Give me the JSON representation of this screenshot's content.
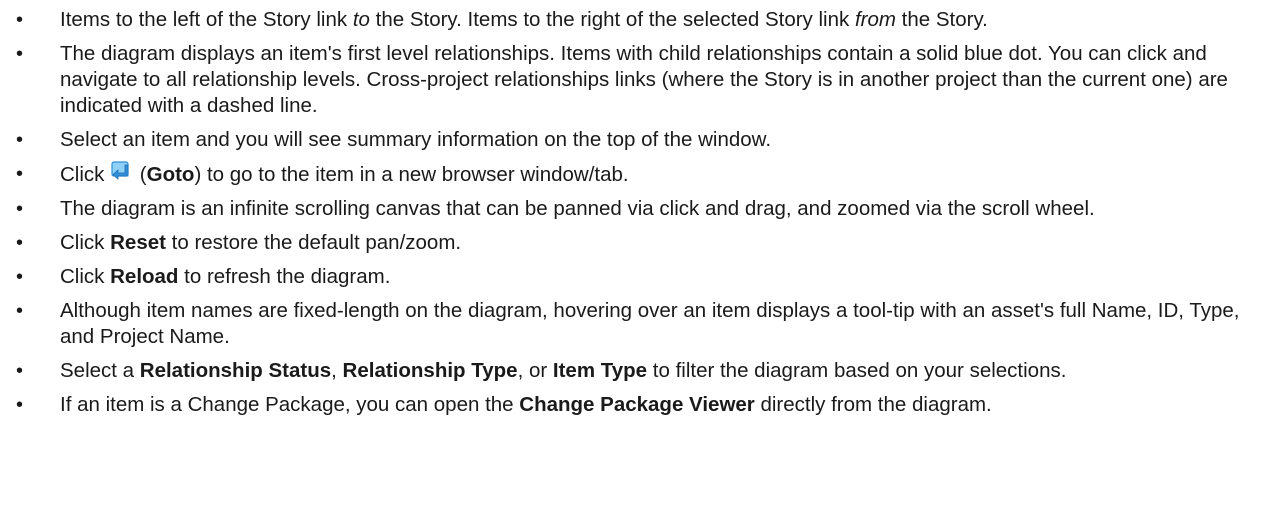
{
  "bullet_glyph": "•",
  "items": {
    "i1": {
      "a": "Items to the left of the Story link ",
      "b": "to",
      "c": " the Story. Items to the right of the selected Story link ",
      "d": "from",
      "e": " the Story."
    },
    "i2": {
      "text": "The diagram displays an item's first level relationships. Items with child relationships contain a solid blue dot. You can click and navigate to all relationship levels. Cross-project relationships links (where the Story is in another project than the current one) are indicated with a dashed line."
    },
    "i3": {
      "text": "Select an item and you will see summary information on the top of the window."
    },
    "i4": {
      "a": "Click ",
      "icon": "goto-arrow-icon",
      "b": " (",
      "bold": "Goto",
      "c": ") to go to the item in a new browser window/tab."
    },
    "i5": {
      "text": "The diagram is an infinite scrolling canvas that can be panned via click and drag, and zoomed via the scroll wheel."
    },
    "i6": {
      "a": "Click ",
      "bold": "Reset",
      "b": " to restore the default pan/zoom."
    },
    "i7": {
      "a": "Click ",
      "bold": "Reload",
      "b": " to refresh the diagram."
    },
    "i8": {
      "text": "Although item names are fixed-length on the diagram, hovering over an item displays a tool-tip with an asset's full Name, ID, Type, and Project Name."
    },
    "i9": {
      "a": "Select a ",
      "bold1": "Relationship Status",
      "b": ", ",
      "bold2": "Relationship Type",
      "c": ", or ",
      "bold3": "Item Type",
      "d": " to filter the diagram based on your selections."
    },
    "i10": {
      "a": "If an item is a Change Package, you can open the ",
      "bold": "Change Package Viewer",
      "b": " directly from the diagram."
    }
  },
  "colors": {
    "text": "#1a1a1a",
    "icon_blue": "#2f8fd8",
    "icon_light": "#8fd0f6"
  }
}
